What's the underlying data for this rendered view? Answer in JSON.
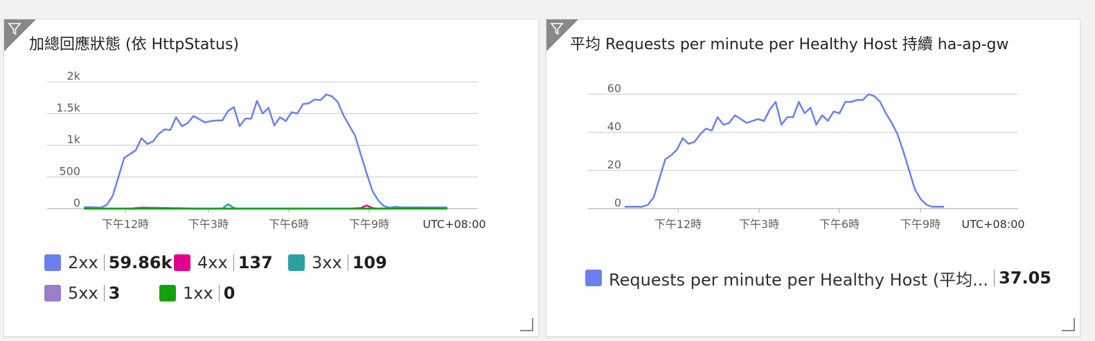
{
  "tiles": [
    {
      "title": "加總回應狀態 (依 HttpStatus)",
      "timezone": "UTC+08:00",
      "legend": [
        {
          "name": "2xx",
          "value": "59.86k",
          "color": "#6b80ee"
        },
        {
          "name": "4xx",
          "value": "137",
          "color": "#e3008c"
        },
        {
          "name": "3xx",
          "value": "109",
          "color": "#2aa0a4"
        },
        {
          "name": "5xx",
          "value": "3",
          "color": "#9c7ec8"
        },
        {
          "name": "1xx",
          "value": "0",
          "color": "#13a10e"
        }
      ]
    },
    {
      "title": "平均 Requests per minute per Healthy Host 持續 ha-ap-gw",
      "timezone": "UTC+08:00",
      "legend": [
        {
          "name": "Requests per minute per Healthy Host (平均...",
          "value": "37.05",
          "color": "#6b80ee"
        }
      ]
    }
  ],
  "chart_data": [
    {
      "type": "line",
      "title": "加總回應狀態 (依 HttpStatus)",
      "x_ticks": [
        "下午12時",
        "下午3時",
        "下午6時",
        "下午9時"
      ],
      "y_ticks": [
        "0",
        "500",
        "1k",
        "1.5k",
        "2k"
      ],
      "ylim": [
        0,
        2000
      ],
      "xlim": [
        0,
        63
      ],
      "grid": true,
      "legend_position": "bottom",
      "series": [
        {
          "name": "2xx",
          "color": "#6b80ee",
          "x": [
            0,
            1,
            2,
            3,
            4,
            5,
            6,
            7,
            8,
            9,
            10,
            11,
            12,
            13,
            14,
            15,
            16,
            17,
            18,
            19,
            20,
            21,
            22,
            23,
            24,
            25,
            26,
            27,
            28,
            29,
            30,
            31,
            32,
            33,
            34,
            35,
            36,
            37,
            38,
            39,
            40,
            41,
            42,
            43,
            44,
            45,
            46,
            47,
            48,
            49,
            50,
            51,
            52,
            53,
            54,
            55,
            56,
            57,
            58,
            59,
            60,
            61,
            62,
            63
          ],
          "y": [
            20,
            25,
            20,
            15,
            60,
            200,
            500,
            800,
            860,
            920,
            1110,
            1020,
            1060,
            1180,
            1250,
            1240,
            1440,
            1300,
            1350,
            1460,
            1410,
            1360,
            1380,
            1390,
            1390,
            1540,
            1600,
            1300,
            1420,
            1420,
            1700,
            1500,
            1590,
            1310,
            1440,
            1380,
            1520,
            1500,
            1650,
            1660,
            1720,
            1710,
            1800,
            1770,
            1680,
            1470,
            1310,
            1150,
            850,
            560,
            280,
            130,
            40,
            15,
            30,
            20,
            20,
            20,
            20,
            20,
            20,
            20,
            20,
            20
          ]
        },
        {
          "name": "4xx",
          "color": "#e3008c",
          "x": [
            0,
            6,
            8,
            10,
            20,
            30,
            40,
            46,
            48,
            49,
            50,
            51,
            53
          ],
          "y": [
            0,
            0,
            0,
            15,
            0,
            0,
            0,
            0,
            10,
            50,
            10,
            0,
            0
          ]
        },
        {
          "name": "3xx",
          "color": "#2aa0a4",
          "x": [
            0,
            10,
            20,
            24,
            25,
            26,
            27,
            30,
            40,
            50,
            51,
            53,
            54,
            63
          ],
          "y": [
            0,
            0,
            0,
            0,
            70,
            10,
            0,
            0,
            0,
            0,
            0,
            0,
            20,
            0
          ]
        },
        {
          "name": "5xx",
          "color": "#9c7ec8",
          "x": [
            0,
            63
          ],
          "y": [
            0,
            0
          ]
        },
        {
          "name": "1xx",
          "color": "#13a10e",
          "x": [
            0,
            63
          ],
          "y": [
            0,
            0
          ]
        }
      ]
    },
    {
      "type": "line",
      "title": "平均 Requests per minute per Healthy Host 持續 ha-ap-gw",
      "x_ticks": [
        "下午12時",
        "下午3時",
        "下午6時",
        "下午9時"
      ],
      "y_ticks": [
        "0",
        "20",
        "40",
        "60"
      ],
      "ylim": [
        0,
        60
      ],
      "xlim": [
        0,
        63
      ],
      "grid": true,
      "legend_position": "bottom",
      "series": [
        {
          "name": "Requests per minute per Healthy Host (平均...",
          "color": "#6b80ee",
          "x": [
            0,
            1,
            2,
            3,
            4,
            5,
            6,
            7,
            8,
            9,
            10,
            11,
            12,
            13,
            14,
            15,
            16,
            17,
            18,
            19,
            20,
            21,
            22,
            23,
            24,
            25,
            26,
            27,
            28,
            29,
            30,
            31,
            32,
            33,
            34,
            35,
            36,
            37,
            38,
            39,
            40,
            41,
            42,
            43,
            44,
            45,
            46,
            47,
            48,
            49,
            50,
            51,
            52,
            53,
            54,
            55
          ],
          "y": [
            1,
            1,
            1,
            1,
            2,
            6,
            16,
            26,
            28,
            31,
            37,
            34,
            35,
            39,
            42,
            41,
            48,
            44,
            45,
            49,
            47,
            45,
            46,
            47,
            46,
            52,
            56,
            44,
            48,
            48,
            56,
            50,
            53,
            44,
            49,
            46,
            51,
            50,
            56,
            56,
            57,
            57,
            60,
            59,
            56,
            50,
            45,
            39,
            30,
            20,
            10,
            5,
            2,
            1,
            1,
            1
          ]
        }
      ]
    }
  ]
}
